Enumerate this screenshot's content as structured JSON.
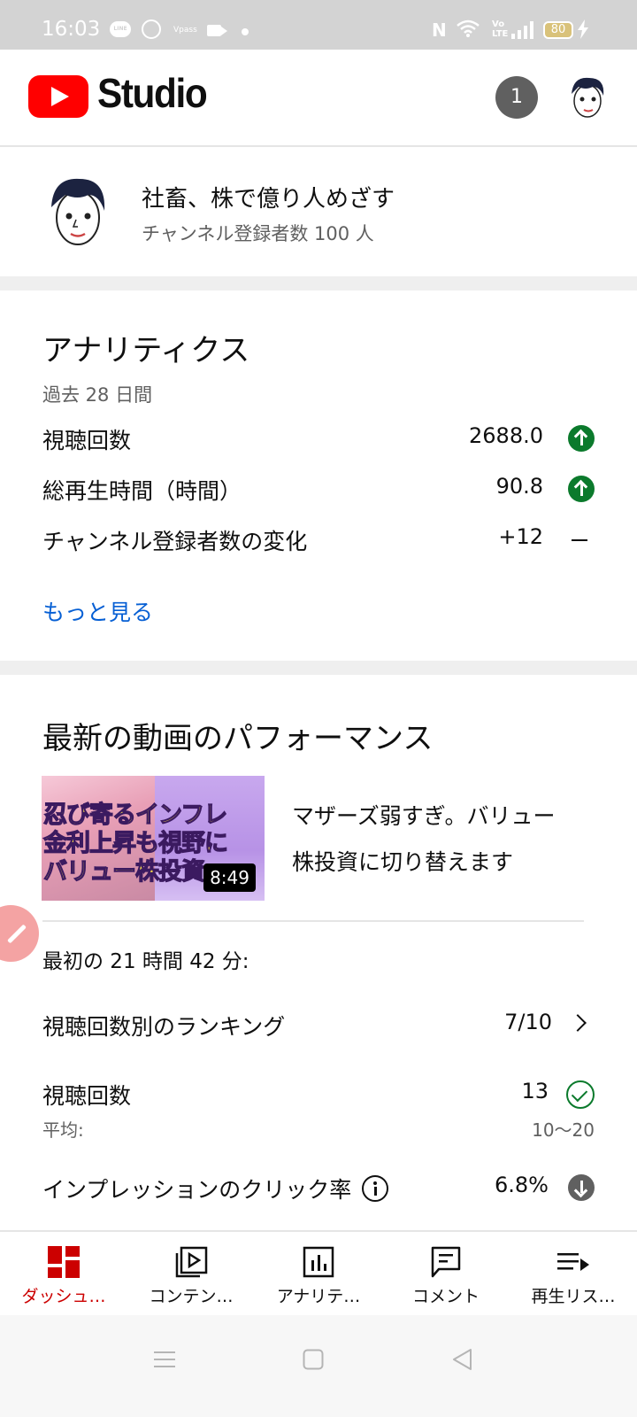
{
  "status_bar": {
    "time": "16:03",
    "battery": "80",
    "icons": [
      "line-icon",
      "check-circle-icon",
      "vpass-icon",
      "video-icon",
      "dot-icon",
      "nfc-icon",
      "wifi-icon",
      "volte-icon",
      "signal-icon",
      "battery-icon",
      "charging-icon"
    ],
    "vpass_text": "Vpass",
    "volte_text": "Vo LTE"
  },
  "header": {
    "app_name": "Studio",
    "notification_count": "1",
    "brand_color": "#ff0000"
  },
  "channel": {
    "name": "社畜、株で億り人めざす",
    "subscribers": "チャンネル登録者数 100 人"
  },
  "analytics": {
    "title": "アナリティクス",
    "period": "過去 28 日間",
    "metrics": [
      {
        "label": "視聴回数",
        "value": "2688.0",
        "trend": "up-icon"
      },
      {
        "label": "総再生時間（時間）",
        "value": "90.8",
        "trend": "up-icon"
      },
      {
        "label": "チャンネル登録者数の変化",
        "value": "+12",
        "trend": "dash-icon"
      }
    ],
    "more_link": "もっと見る"
  },
  "latest_video": {
    "section_title": "最新の動画のパフォーマンス",
    "thumbnail_text": [
      "忍び寄るインフレ",
      "金利上昇も視野に",
      "バリュー株投資"
    ],
    "duration": "8:49",
    "title_line1": "マザーズ弱すぎ。バリュー",
    "title_line2": "株投資に切り替えます",
    "first_period": "最初の 21 時間 42 分:",
    "ranking_label": "視聴回数別のランキング",
    "ranking_value": "7/10",
    "views_label": "視聴回数",
    "views_value": "13",
    "average_label": "平均:",
    "average_value": "10〜20",
    "ctr_label": "インプレッションのクリック率",
    "ctr_value": "6.8%"
  },
  "bottom_nav": [
    {
      "label": "ダッシュ…",
      "icon": "dashboard-icon",
      "active": true
    },
    {
      "label": "コンテン…",
      "icon": "content-icon",
      "active": false
    },
    {
      "label": "アナリテ…",
      "icon": "analytics-icon",
      "active": false
    },
    {
      "label": "コメント",
      "icon": "comment-icon",
      "active": false
    },
    {
      "label": "再生リス…",
      "icon": "playlist-icon",
      "active": false
    }
  ],
  "system_nav": [
    "menu-icon",
    "home-icon",
    "back-icon"
  ],
  "colors": {
    "accent_red": "#cc0000",
    "trend_up_green": "#0b7a2c",
    "link_blue": "#065fd4"
  }
}
